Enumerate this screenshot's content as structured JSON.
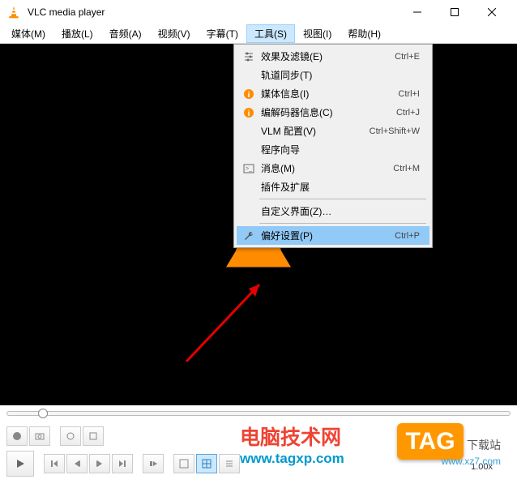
{
  "titlebar": {
    "title": "VLC media player"
  },
  "menubar": {
    "items": [
      {
        "label": "媒体(M)"
      },
      {
        "label": "播放(L)"
      },
      {
        "label": "音频(A)"
      },
      {
        "label": "视频(V)"
      },
      {
        "label": "字幕(T)"
      },
      {
        "label": "工具(S)",
        "open": true
      },
      {
        "label": "视图(I)"
      },
      {
        "label": "帮助(H)"
      }
    ]
  },
  "dropdown": {
    "items": [
      {
        "icon": "sliders",
        "label": "效果及滤镜(E)",
        "shortcut": "Ctrl+E"
      },
      {
        "icon": "",
        "label": "轨道同步(T)",
        "shortcut": ""
      },
      {
        "icon": "info",
        "label": "媒体信息(I)",
        "shortcut": "Ctrl+I"
      },
      {
        "icon": "info",
        "label": "编解码器信息(C)",
        "shortcut": "Ctrl+J"
      },
      {
        "icon": "",
        "label": "VLM 配置(V)",
        "shortcut": "Ctrl+Shift+W"
      },
      {
        "icon": "",
        "label": "程序向导",
        "shortcut": ""
      },
      {
        "icon": "console",
        "label": "消息(M)",
        "shortcut": "Ctrl+M"
      },
      {
        "icon": "",
        "label": "插件及扩展",
        "shortcut": ""
      }
    ],
    "sep1": true,
    "customize": {
      "label": "自定义界面(Z)…",
      "shortcut": ""
    },
    "sep2": true,
    "prefs": {
      "icon": "wrench",
      "label": "偏好设置(P)",
      "shortcut": "Ctrl+P",
      "highlight": true
    }
  },
  "statusbar": {
    "speed": "1.00x"
  },
  "watermark": {
    "site1_name": "电脑技术网",
    "site1_url": "www.tagxp.com",
    "site2_badge": "TAG",
    "site2_sub": "下载站",
    "site2_url": "www.xz7.com"
  }
}
